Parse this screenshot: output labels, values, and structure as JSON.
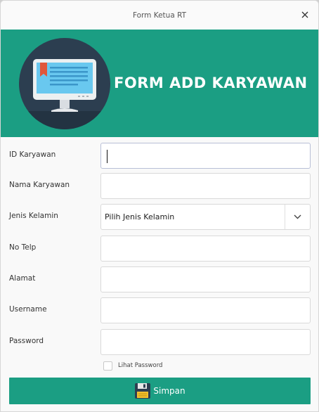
{
  "window": {
    "title": "Form Ketua RT",
    "close_icon": "close-icon"
  },
  "banner": {
    "title": "FORM ADD KARYAWAN",
    "icon": "monitor-icon",
    "background_color": "#1b9e83"
  },
  "form": {
    "fields": [
      {
        "label": "ID Karyawan",
        "value": "",
        "focused": true
      },
      {
        "label": "Nama Karyawan",
        "value": ""
      },
      {
        "label": "Jenis Kelamin",
        "type": "select",
        "selected": "Pilih Jenis Kelamin"
      },
      {
        "label": "No Telp",
        "value": ""
      },
      {
        "label": "Alamat",
        "value": ""
      },
      {
        "label": "Username",
        "value": ""
      },
      {
        "label": "Password",
        "value": ""
      }
    ],
    "show_password_label": "Lihat Password",
    "show_password_checked": false,
    "save_label": "Simpan",
    "save_icon": "floppy-disk-icon"
  }
}
